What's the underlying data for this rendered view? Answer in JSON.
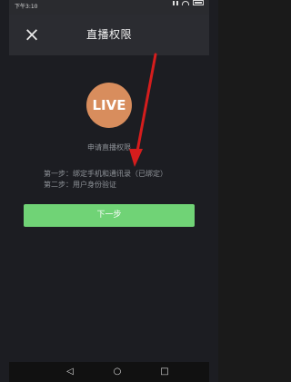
{
  "status": {
    "time": "下午3:10"
  },
  "header": {
    "title": "直播权限"
  },
  "icons": {
    "close": "×",
    "live": "LIVE"
  },
  "content": {
    "apply": "申请直播权限",
    "steps": [
      "第一步：绑定手机和通讯录（已绑定）",
      "第二步：用户身份验证"
    ],
    "next": "下一步"
  }
}
